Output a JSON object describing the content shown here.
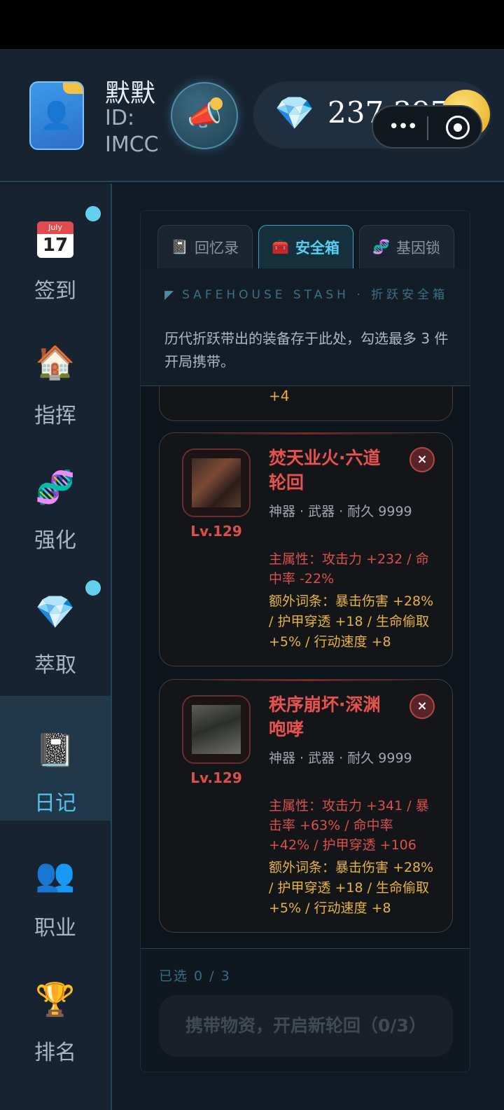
{
  "header": {
    "username": "默默",
    "user_id": "ID: IMCC",
    "gem_count": "237,397",
    "plus_label": "+"
  },
  "sidebar": {
    "items": [
      {
        "label": "签到",
        "icon": "calendar-icon",
        "calendar_month": "July",
        "calendar_day": "17",
        "has_dot": true
      },
      {
        "label": "指挥",
        "icon": "house-icon",
        "glyph": "🏠"
      },
      {
        "label": "强化",
        "icon": "dna-icon",
        "glyph": "🧬"
      },
      {
        "label": "萃取",
        "icon": "gem-icon",
        "glyph": "💎",
        "has_dot": true
      },
      {
        "label": "日记",
        "icon": "notebook-icon",
        "glyph": "📓",
        "active": true
      },
      {
        "label": "职业",
        "icon": "people-icon",
        "glyph": "👥"
      },
      {
        "label": "排名",
        "icon": "trophy-icon",
        "glyph": "🏆"
      }
    ]
  },
  "tabs": [
    {
      "label": "回忆录",
      "icon": "notebook-icon",
      "glyph": "📓"
    },
    {
      "label": "安全箱",
      "icon": "toolbox-icon",
      "glyph": "🧰",
      "active": true
    },
    {
      "label": "基因锁",
      "icon": "dna-icon",
      "glyph": "🧬"
    }
  ],
  "stash": {
    "title": "SAFEHOUSE STASH · 折跃安全箱",
    "description": "历代折跃带出的装备存于此处，勾选最多 3 件开局携带。",
    "partial_text": "+4"
  },
  "items": [
    {
      "name": "焚天业火·六道轮回",
      "level": "Lv.129",
      "meta": "神器 · 武器 · 耐久 9999",
      "main_attr": "主属性：攻击力 +232 / 命中率 -22%",
      "extra": "额外词条：暴击伤害 +28% / 护甲穿透 +18 / 生命偷取 +5% / 行动速度 +8",
      "close": "×"
    },
    {
      "name": "秩序崩坏·深渊咆哮",
      "level": "Lv.129",
      "meta": "神器 · 武器 · 耐久 9999",
      "main_attr": "主属性：攻击力 +341 / 暴击率 +63% / 命中率 +42% / 护甲穿透 +106",
      "extra": "额外词条：暴击伤害 +28% / 护甲穿透 +18 / 生命偷取 +5% / 行动速度 +8",
      "close": "×"
    }
  ],
  "footer": {
    "selected": "已选 0 / 3",
    "button": "携带物资，开启新轮回（0/3）"
  },
  "colors": {
    "accent": "#55d0f3",
    "danger": "#d9504c",
    "gold": "#e5b43e"
  }
}
